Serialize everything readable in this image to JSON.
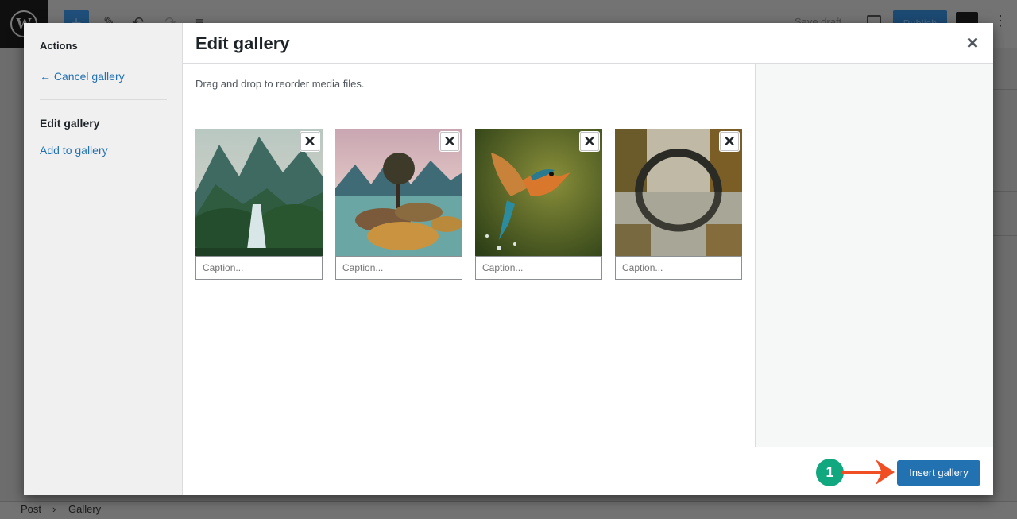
{
  "colors": {
    "accent": "#2271b1",
    "badge": "#11a77f",
    "arrow": "#f04e23",
    "overlay": "#6d6d6d"
  },
  "background_editor": {
    "save_draft": "Save draft",
    "publish": "Publish",
    "breadcrumb": [
      "Post",
      "Gallery"
    ]
  },
  "menu": {
    "heading": "Actions",
    "cancel_gallery": "← Cancel gallery",
    "edit_gallery": "Edit gallery",
    "add_to_gallery": "Add to gallery"
  },
  "modal": {
    "title": "Edit gallery",
    "close_icon": "close-icon",
    "instructions": "Drag and drop to reorder media files."
  },
  "attachments": [
    {
      "image": "mountain-waterfall-landscape",
      "caption_placeholder": "Caption..."
    },
    {
      "image": "tree-on-rocky-lake",
      "caption_placeholder": "Caption..."
    },
    {
      "image": "kingfisher-bird",
      "caption_placeholder": "Caption..."
    },
    {
      "image": "stone-bridge-reflection",
      "caption_placeholder": "Caption..."
    }
  ],
  "toolbar": {
    "insert_gallery": "Insert gallery"
  },
  "annotation": {
    "step": "1"
  }
}
